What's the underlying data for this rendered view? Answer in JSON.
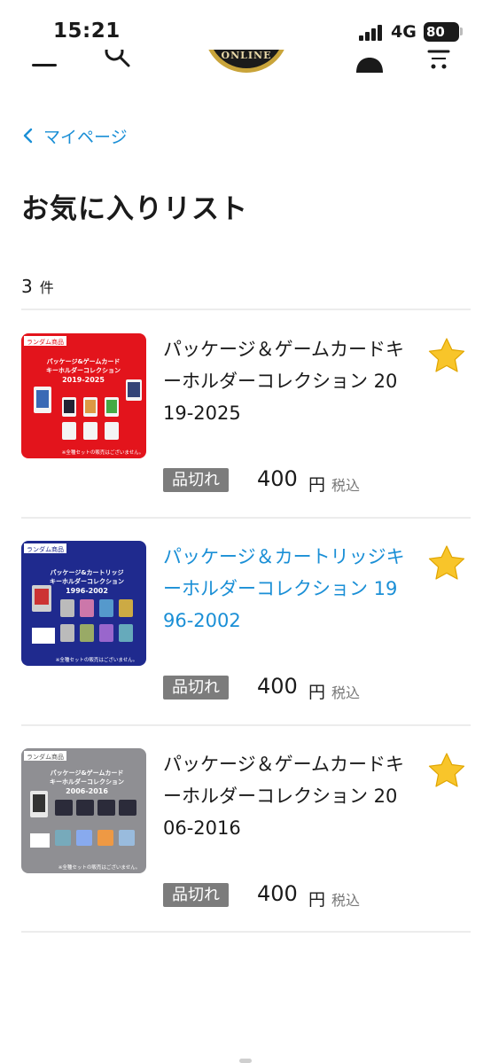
{
  "status_bar": {
    "time": "15:21",
    "network": "4G",
    "battery": "80"
  },
  "header": {
    "logo_text": "ONLINE",
    "icons": [
      "menu-icon",
      "search-icon",
      "account-icon",
      "cart-icon"
    ]
  },
  "breadcrumb": {
    "label": "マイページ"
  },
  "page": {
    "title": "お気に入りリスト",
    "count": "3",
    "count_unit": "件"
  },
  "colors": {
    "link": "#1a8fd6",
    "soldout_badge": "#7c7c7c",
    "star": "#f8c52a"
  },
  "items": [
    {
      "title": "パッケージ＆ゲームカードキーホルダーコレクション 2019-2025",
      "status": "品切れ",
      "price": "400",
      "currency": "円",
      "tax": "税込",
      "thumb_color": "#e3141c",
      "thumb_tag": "ランダム商品",
      "thumb_title_1": "パッケージ&ゲームカード",
      "thumb_title_2": "キーホルダーコレクション",
      "thumb_years": "2019-2025",
      "thumb_note": "※全種セットの販売はございません。"
    },
    {
      "title": "パッケージ＆カートリッジキーホルダーコレクション 1996-2002",
      "status": "品切れ",
      "price": "400",
      "currency": "円",
      "tax": "税込",
      "thumb_color": "#1f2a8e",
      "thumb_tag": "ランダム商品",
      "thumb_title_1": "パッケージ&カートリッジ",
      "thumb_title_2": "キーホルダーコレクション",
      "thumb_years": "1996-2002",
      "thumb_note": "※全種セットの販売はございません。"
    },
    {
      "title": "パッケージ＆ゲームカードキーホルダーコレクション 2006-2016",
      "status": "品切れ",
      "price": "400",
      "currency": "円",
      "tax": "税込",
      "thumb_color": "#8f8f93",
      "thumb_tag": "ランダム商品",
      "thumb_title_1": "パッケージ&ゲームカード",
      "thumb_title_2": "キーホルダーコレクション",
      "thumb_years": "2006-2016",
      "thumb_note": "※全種セットの販売はございません。"
    }
  ]
}
